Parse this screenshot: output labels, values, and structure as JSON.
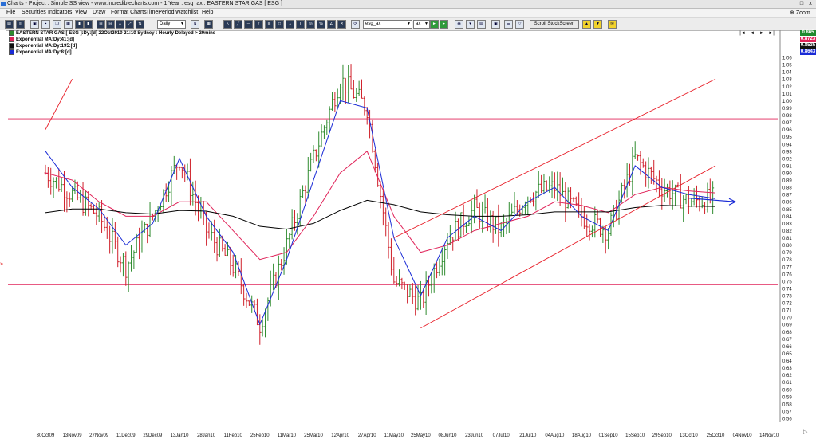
{
  "window": {
    "title": "Charts - Project : Simple SS view - www.incrediblecharts.com - 1 Year : esg_ax : EASTERN STAR GAS  [ ESG ]",
    "min_label": "_",
    "max_label": "□",
    "close_label": "x"
  },
  "menu": {
    "items": [
      "File",
      "Securities",
      "Indicators",
      "View",
      "Draw",
      "Format Charts",
      "TimePeriod",
      "Watchlist",
      "Help"
    ],
    "zoom_label": "Zoom"
  },
  "toolbar": {
    "period_value": "Daily",
    "security_value": "esg_ax",
    "exchange_value": "ax",
    "scroll_label": "Scroll StockScreen"
  },
  "legend": {
    "items": [
      {
        "label": "EASTERN STAR GAS [ ESG ]:Dy:[d]  22Oct2010 21:10 Sydney : Hourly Delayed > 20mins",
        "color": "#000000"
      },
      {
        "label": "Exponential MA:Dy:41:[d]",
        "color": "#e0245a"
      },
      {
        "label": "Exponential MA:Dy:195:[d]",
        "color": "#000000"
      },
      {
        "label": "Exponential MA:Dy:8:[d]",
        "color": "#1a2bd6"
      }
    ]
  },
  "nav": [
    "|◄",
    "◄",
    "►",
    "►|"
  ],
  "price_boxes": [
    {
      "value": "0.865",
      "color": "#1f8a2e"
    },
    {
      "value": "0.8723",
      "color": "#e0245a"
    },
    {
      "value": "0.8535",
      "color": "#111111"
    },
    {
      "value": "0.8643",
      "color": "#1a2bd6"
    }
  ],
  "chart_data": {
    "type": "ohlc",
    "title": "EASTERN STAR GAS [ ESG ]",
    "ylim": [
      0.56,
      1.07
    ],
    "y_ticks": [
      "1.06",
      "1.05",
      "1.04",
      "1.03",
      "1.02",
      "1.01",
      "1.00",
      "0.99",
      "0.98",
      "0.97",
      "0.96",
      "0.95",
      "0.94",
      "0.93",
      "0.92",
      "0.91",
      "0.90",
      "0.89",
      "0.88",
      "0.87",
      "0.86",
      "0.85",
      "0.84",
      "0.83",
      "0.82",
      "0.81",
      "0.80",
      "0.79",
      "0.78",
      "0.77",
      "0.76",
      "0.75",
      "0.74",
      "0.73",
      "0.72",
      "0.71",
      "0.70",
      "0.69",
      "0.68",
      "0.67",
      "0.66",
      "0.65",
      "0.64",
      "0.63",
      "0.62",
      "0.61",
      "0.60",
      "0.59",
      "0.58",
      "0.57",
      "0.56"
    ],
    "x_ticks": [
      "30Oct09",
      "13Nov09",
      "27Nov09",
      "11Dec09",
      "29Dec09",
      "13Jan10",
      "28Jan10",
      "11Feb10",
      "25Feb10",
      "11Mar10",
      "25Mar10",
      "12Apr10",
      "27Apr10",
      "11May10",
      "25May10",
      "08Jun10",
      "23Jun10",
      "07Jul10",
      "21Jul10",
      "04Aug10",
      "18Aug10",
      "01Sep10",
      "15Sep10",
      "29Sep10",
      "13Oct10",
      "25Oct10",
      "04Nov10",
      "14Nov10"
    ],
    "close_series": [
      {
        "date": "30Oct09",
        "value": 0.9
      },
      {
        "date": "13Nov09",
        "value": 0.87
      },
      {
        "date": "27Nov09",
        "value": 0.84
      },
      {
        "date": "11Dec09",
        "value": 0.77
      },
      {
        "date": "29Dec09",
        "value": 0.84
      },
      {
        "date": "13Jan10",
        "value": 0.92
      },
      {
        "date": "28Jan10",
        "value": 0.82
      },
      {
        "date": "11Feb10",
        "value": 0.77
      },
      {
        "date": "25Feb10",
        "value": 0.69
      },
      {
        "date": "11Mar10",
        "value": 0.8
      },
      {
        "date": "25Mar10",
        "value": 0.92
      },
      {
        "date": "12Apr10",
        "value": 1.03
      },
      {
        "date": "27Apr10",
        "value": 0.99
      },
      {
        "date": "11May10",
        "value": 0.75
      },
      {
        "date": "25May10",
        "value": 0.72
      },
      {
        "date": "08Jun10",
        "value": 0.81
      },
      {
        "date": "23Jun10",
        "value": 0.85
      },
      {
        "date": "07Jul10",
        "value": 0.82
      },
      {
        "date": "21Jul10",
        "value": 0.87
      },
      {
        "date": "04Aug10",
        "value": 0.88
      },
      {
        "date": "18Aug10",
        "value": 0.84
      },
      {
        "date": "01Sep10",
        "value": 0.82
      },
      {
        "date": "15Sep10",
        "value": 0.92
      },
      {
        "date": "29Sep10",
        "value": 0.88
      },
      {
        "date": "13Oct10",
        "value": 0.86
      },
      {
        "date": "25Oct10",
        "value": 0.865
      }
    ],
    "series": [
      {
        "name": "Exponential MA:Dy:41:[d]",
        "color": "#e0245a",
        "points": [
          {
            "date": "30Oct09",
            "value": 0.9
          },
          {
            "date": "13Nov09",
            "value": 0.89
          },
          {
            "date": "27Nov09",
            "value": 0.86
          },
          {
            "date": "11Dec09",
            "value": 0.84
          },
          {
            "date": "29Dec09",
            "value": 0.84
          },
          {
            "date": "13Jan10",
            "value": 0.86
          },
          {
            "date": "28Jan10",
            "value": 0.86
          },
          {
            "date": "11Feb10",
            "value": 0.82
          },
          {
            "date": "25Feb10",
            "value": 0.78
          },
          {
            "date": "11Mar10",
            "value": 0.79
          },
          {
            "date": "25Mar10",
            "value": 0.84
          },
          {
            "date": "12Apr10",
            "value": 0.9
          },
          {
            "date": "27Apr10",
            "value": 0.93
          },
          {
            "date": "11May10",
            "value": 0.84
          },
          {
            "date": "25May10",
            "value": 0.79
          },
          {
            "date": "08Jun10",
            "value": 0.8
          },
          {
            "date": "23Jun10",
            "value": 0.82
          },
          {
            "date": "07Jul10",
            "value": 0.83
          },
          {
            "date": "21Jul10",
            "value": 0.84
          },
          {
            "date": "04Aug10",
            "value": 0.86
          },
          {
            "date": "18Aug10",
            "value": 0.855
          },
          {
            "date": "01Sep10",
            "value": 0.845
          },
          {
            "date": "15Sep10",
            "value": 0.87
          },
          {
            "date": "29Sep10",
            "value": 0.88
          },
          {
            "date": "13Oct10",
            "value": 0.875
          },
          {
            "date": "25Oct10",
            "value": 0.8723
          }
        ]
      },
      {
        "name": "Exponential MA:Dy:195:[d]",
        "color": "#000000",
        "points": [
          {
            "date": "30Oct09",
            "value": 0.845
          },
          {
            "date": "13Nov09",
            "value": 0.85
          },
          {
            "date": "27Nov09",
            "value": 0.85
          },
          {
            "date": "11Dec09",
            "value": 0.845
          },
          {
            "date": "29Dec09",
            "value": 0.843
          },
          {
            "date": "13Jan10",
            "value": 0.848
          },
          {
            "date": "28Jan10",
            "value": 0.847
          },
          {
            "date": "11Feb10",
            "value": 0.84
          },
          {
            "date": "25Feb10",
            "value": 0.826
          },
          {
            "date": "11Mar10",
            "value": 0.822
          },
          {
            "date": "25Mar10",
            "value": 0.83
          },
          {
            "date": "12Apr10",
            "value": 0.848
          },
          {
            "date": "27Apr10",
            "value": 0.862
          },
          {
            "date": "11May10",
            "value": 0.856
          },
          {
            "date": "25May10",
            "value": 0.846
          },
          {
            "date": "08Jun10",
            "value": 0.842
          },
          {
            "date": "23Jun10",
            "value": 0.84
          },
          {
            "date": "07Jul10",
            "value": 0.84
          },
          {
            "date": "21Jul10",
            "value": 0.842
          },
          {
            "date": "04Aug10",
            "value": 0.846
          },
          {
            "date": "18Aug10",
            "value": 0.846
          },
          {
            "date": "01Sep10",
            "value": 0.846
          },
          {
            "date": "15Sep10",
            "value": 0.852
          },
          {
            "date": "29Sep10",
            "value": 0.855
          },
          {
            "date": "13Oct10",
            "value": 0.854
          },
          {
            "date": "25Oct10",
            "value": 0.8535
          }
        ]
      },
      {
        "name": "Exponential MA:Dy:8:[d]",
        "color": "#1a2bd6",
        "points": [
          {
            "date": "30Oct09",
            "value": 0.93
          },
          {
            "date": "13Nov09",
            "value": 0.88
          },
          {
            "date": "27Nov09",
            "value": 0.85
          },
          {
            "date": "11Dec09",
            "value": 0.8
          },
          {
            "date": "29Dec09",
            "value": 0.83
          },
          {
            "date": "13Jan10",
            "value": 0.92
          },
          {
            "date": "28Jan10",
            "value": 0.84
          },
          {
            "date": "11Feb10",
            "value": 0.79
          },
          {
            "date": "25Feb10",
            "value": 0.69
          },
          {
            "date": "11Mar10",
            "value": 0.78
          },
          {
            "date": "25Mar10",
            "value": 0.89
          },
          {
            "date": "12Apr10",
            "value": 1.0
          },
          {
            "date": "27Apr10",
            "value": 0.99
          },
          {
            "date": "11May10",
            "value": 0.81
          },
          {
            "date": "25May10",
            "value": 0.73
          },
          {
            "date": "08Jun10",
            "value": 0.81
          },
          {
            "date": "23Jun10",
            "value": 0.84
          },
          {
            "date": "07Jul10",
            "value": 0.82
          },
          {
            "date": "21Jul10",
            "value": 0.86
          },
          {
            "date": "04Aug10",
            "value": 0.88
          },
          {
            "date": "18Aug10",
            "value": 0.84
          },
          {
            "date": "01Sep10",
            "value": 0.82
          },
          {
            "date": "15Sep10",
            "value": 0.91
          },
          {
            "date": "29Sep10",
            "value": 0.88
          },
          {
            "date": "13Oct10",
            "value": 0.87
          },
          {
            "date": "25Oct10",
            "value": 0.8643
          }
        ]
      }
    ],
    "horizontal_lines": [
      {
        "value": 0.975,
        "color": "#e0245a"
      },
      {
        "value": 0.745,
        "color": "#e0245a"
      }
    ],
    "trend_lines": [
      {
        "from": {
          "date": "30Oct09",
          "value": 0.96
        },
        "to": {
          "date": "13Nov09",
          "value": 1.03
        },
        "color": "#e8202a"
      },
      {
        "from": {
          "date": "11May10",
          "value": 0.81
        },
        "to": {
          "date": "25Oct10",
          "value": 1.03
        },
        "color": "#e8202a"
      },
      {
        "from": {
          "date": "25May10",
          "value": 0.685
        },
        "to": {
          "date": "25Oct10",
          "value": 0.91
        },
        "color": "#e8202a"
      }
    ],
    "arrow": {
      "from": {
        "date": "13Oct10",
        "value": 0.865
      },
      "to": {
        "date": "25Oct10",
        "value": 0.86
      },
      "color": "#1a2bd6"
    },
    "bar_colors": {
      "up": "#2e8b2e",
      "down": "#d0202a"
    },
    "grid": false
  }
}
